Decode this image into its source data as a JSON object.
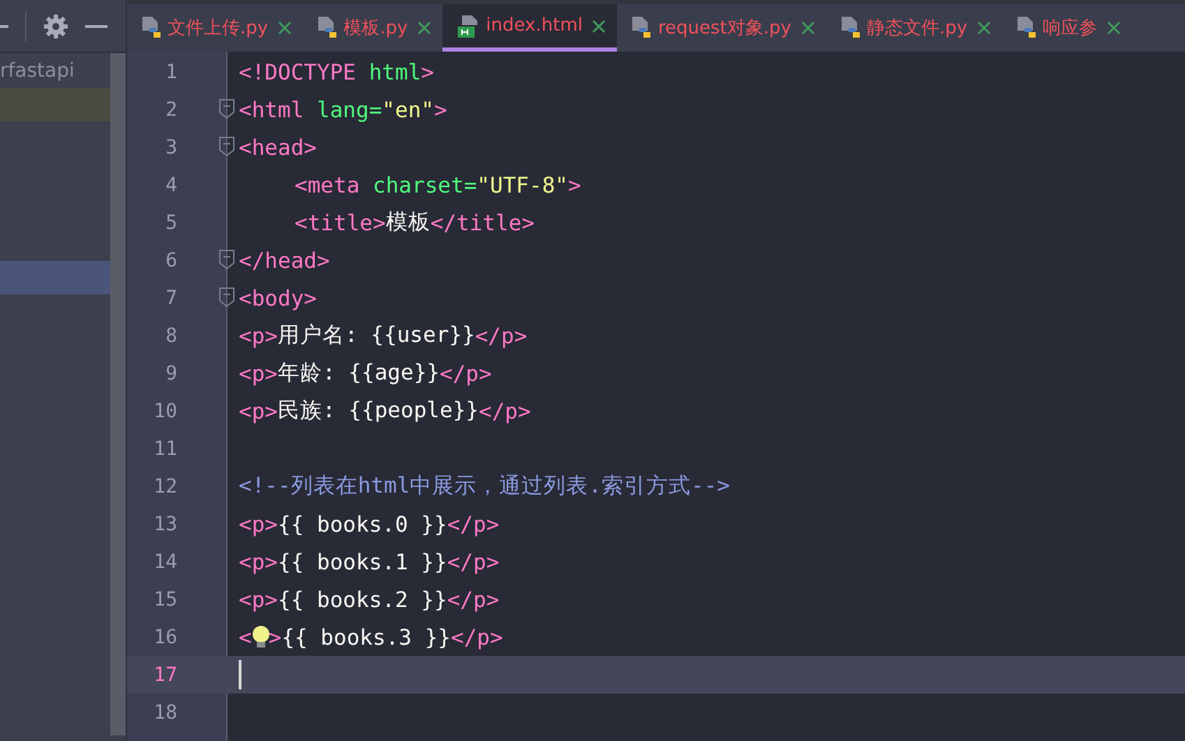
{
  "project_panel": {
    "root_label": "rfastapi"
  },
  "tabs": [
    {
      "label": "文件上传.py",
      "kind": "python",
      "selected": false
    },
    {
      "label": "模板.py",
      "kind": "python",
      "selected": false
    },
    {
      "label": "index.html",
      "kind": "html",
      "selected": true
    },
    {
      "label": "request对象.py",
      "kind": "python",
      "selected": false
    },
    {
      "label": "静态文件.py",
      "kind": "python",
      "selected": false
    },
    {
      "label": "响应参",
      "kind": "python",
      "selected": false
    }
  ],
  "editor": {
    "lines": [
      {
        "number": "1",
        "fold": false,
        "indented": false,
        "current": false,
        "tokens": [
          {
            "kind": "tag",
            "text": "<!DOCTYPE"
          },
          {
            "kind": "attr",
            "text": " html"
          },
          {
            "kind": "tag",
            "text": ">"
          }
        ]
      },
      {
        "number": "2",
        "fold": true,
        "indented": false,
        "current": false,
        "tokens": [
          {
            "kind": "tag",
            "text": "<html"
          },
          {
            "kind": "attr",
            "text": " lang="
          },
          {
            "kind": "string",
            "text": "\"en\""
          },
          {
            "kind": "tag",
            "text": ">"
          }
        ]
      },
      {
        "number": "3",
        "fold": true,
        "indented": false,
        "current": false,
        "tokens": [
          {
            "kind": "tag",
            "text": "<head>"
          }
        ]
      },
      {
        "number": "4",
        "fold": false,
        "indented": true,
        "current": false,
        "tokens": [
          {
            "kind": "tag",
            "text": "<meta"
          },
          {
            "kind": "attr",
            "text": " charset="
          },
          {
            "kind": "string",
            "text": "\"UTF-8\""
          },
          {
            "kind": "tag",
            "text": ">"
          }
        ]
      },
      {
        "number": "5",
        "fold": false,
        "indented": true,
        "current": false,
        "tokens": [
          {
            "kind": "tag",
            "text": "<title>"
          },
          {
            "kind": "text",
            "text": "模板"
          },
          {
            "kind": "tag",
            "text": "</title>"
          }
        ]
      },
      {
        "number": "6",
        "fold": true,
        "indented": false,
        "current": false,
        "tokens": [
          {
            "kind": "tag",
            "text": "</head>"
          }
        ]
      },
      {
        "number": "7",
        "fold": true,
        "indented": false,
        "current": false,
        "tokens": [
          {
            "kind": "tag",
            "text": "<body>"
          }
        ]
      },
      {
        "number": "8",
        "fold": false,
        "indented": false,
        "current": false,
        "tokens": [
          {
            "kind": "tag",
            "text": "<p>"
          },
          {
            "kind": "text",
            "text": "用户名: {{user}}"
          },
          {
            "kind": "tag",
            "text": "</p>"
          }
        ]
      },
      {
        "number": "9",
        "fold": false,
        "indented": false,
        "current": false,
        "tokens": [
          {
            "kind": "tag",
            "text": "<p>"
          },
          {
            "kind": "text",
            "text": "年龄: {{age}}"
          },
          {
            "kind": "tag",
            "text": "</p>"
          }
        ]
      },
      {
        "number": "10",
        "fold": false,
        "indented": false,
        "current": false,
        "tokens": [
          {
            "kind": "tag",
            "text": "<p>"
          },
          {
            "kind": "text",
            "text": "民族: {{people}}"
          },
          {
            "kind": "tag",
            "text": "</p>"
          }
        ]
      },
      {
        "number": "11",
        "fold": false,
        "current": false
      },
      {
        "number": "12",
        "fold": false,
        "indented": false,
        "current": false,
        "tokens": [
          {
            "kind": "comment",
            "text": "<!--列表在html中展示，通过列表.索引方式-->"
          }
        ]
      },
      {
        "number": "13",
        "fold": false,
        "indented": false,
        "current": false,
        "tokens": [
          {
            "kind": "tag",
            "text": "<p>"
          },
          {
            "kind": "text",
            "text": "{{ books.0 }}"
          },
          {
            "kind": "tag",
            "text": "</p>"
          }
        ]
      },
      {
        "number": "14",
        "fold": false,
        "indented": false,
        "current": false,
        "tokens": [
          {
            "kind": "tag",
            "text": "<p>"
          },
          {
            "kind": "text",
            "text": "{{ books.1 }}"
          },
          {
            "kind": "tag",
            "text": "</p>"
          }
        ]
      },
      {
        "number": "15",
        "fold": false,
        "indented": false,
        "current": false,
        "tokens": [
          {
            "kind": "tag",
            "text": "<p>"
          },
          {
            "kind": "text",
            "text": "{{ books.2 }}"
          },
          {
            "kind": "tag",
            "text": "</p>"
          }
        ]
      },
      {
        "number": "16",
        "fold": false,
        "indented": false,
        "current": false,
        "tokens": [
          {
            "kind": "tag",
            "text": "<"
          },
          {
            "kind": "bulb"
          },
          {
            "kind": "tag",
            "text": ">"
          },
          {
            "kind": "text",
            "text": "{{ books.3 }}"
          },
          {
            "kind": "tag",
            "text": "</p>"
          }
        ]
      },
      {
        "number": "17",
        "fold": false,
        "indented": false,
        "current": true,
        "tokens": [
          {
            "kind": "caret"
          }
        ]
      },
      {
        "number": "18",
        "fold": false,
        "current": false
      }
    ]
  }
}
